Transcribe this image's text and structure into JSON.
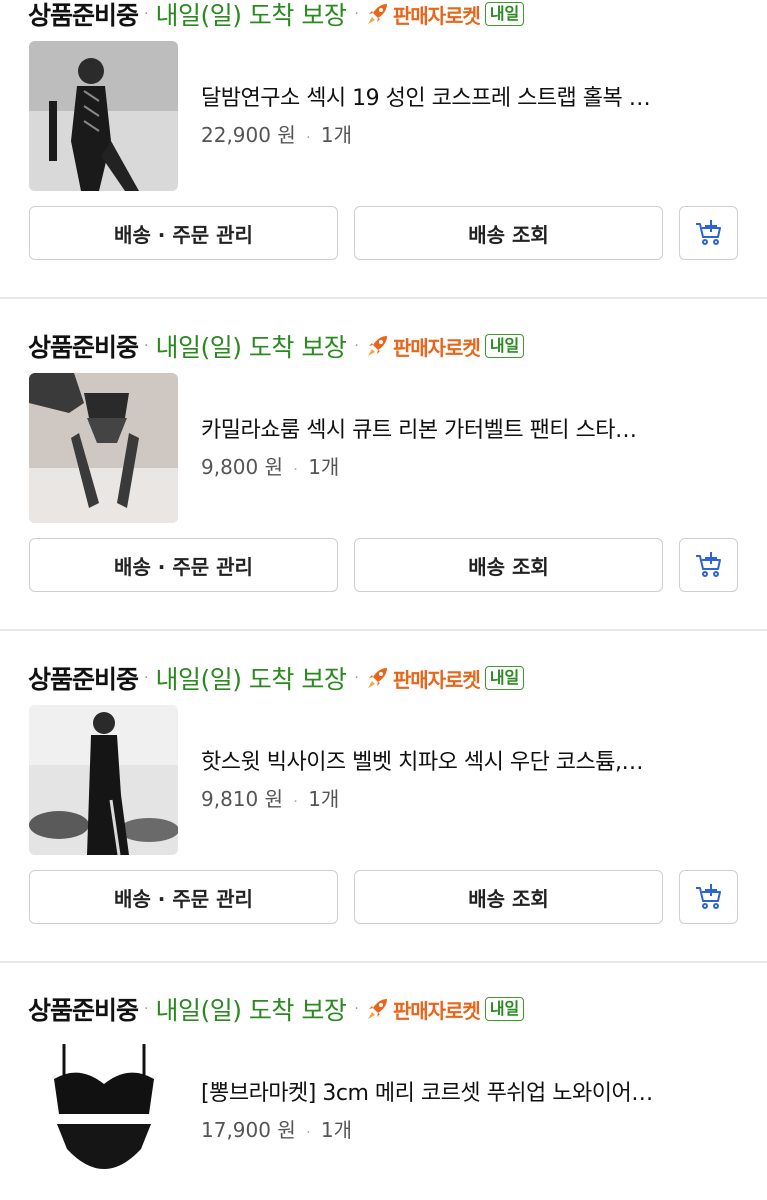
{
  "orders": [
    {
      "status": "상품준비중",
      "separator": "·",
      "arrival": "내일(일) 도착 보장",
      "brand": "판매자로켓",
      "badge": "내일",
      "product_name": "달밤연구소 섹시 19 성인 코스프레 스트랩 홀복 …",
      "price": "22,900 원",
      "quantity": "1개",
      "manage_button": "배송 · 주문 관리",
      "track_button": "배송 조회"
    },
    {
      "status": "상품준비중",
      "separator": "·",
      "arrival": "내일(일) 도착 보장",
      "brand": "판매자로켓",
      "badge": "내일",
      "product_name": "카밀라쇼룸 섹시 큐트 리본 가터벨트 팬티 스타…",
      "price": "9,800 원",
      "quantity": "1개",
      "manage_button": "배송 · 주문 관리",
      "track_button": "배송 조회"
    },
    {
      "status": "상품준비중",
      "separator": "·",
      "arrival": "내일(일) 도착 보장",
      "brand": "판매자로켓",
      "badge": "내일",
      "product_name": "핫스윗 빅사이즈 벨벳 치파오 섹시 우단 코스튬,…",
      "price": "9,810 원",
      "quantity": "1개",
      "manage_button": "배송 · 주문 관리",
      "track_button": "배송 조회"
    },
    {
      "status": "상품준비중",
      "separator": "·",
      "arrival": "내일(일) 도착 보장",
      "brand": "판매자로켓",
      "badge": "내일",
      "product_name": "[뽕브라마켓] 3cm 메리 코르셋 푸쉬업 노와이어…",
      "price": "17,900 원",
      "quantity": "1개"
    }
  ],
  "colors": {
    "arrival_green": "#2a8a1f",
    "brand_orange": "#e8651a",
    "cart_blue": "#2e63d6"
  },
  "icons": {
    "cart": "cart-add-icon",
    "rocket": "rocket-icon"
  }
}
